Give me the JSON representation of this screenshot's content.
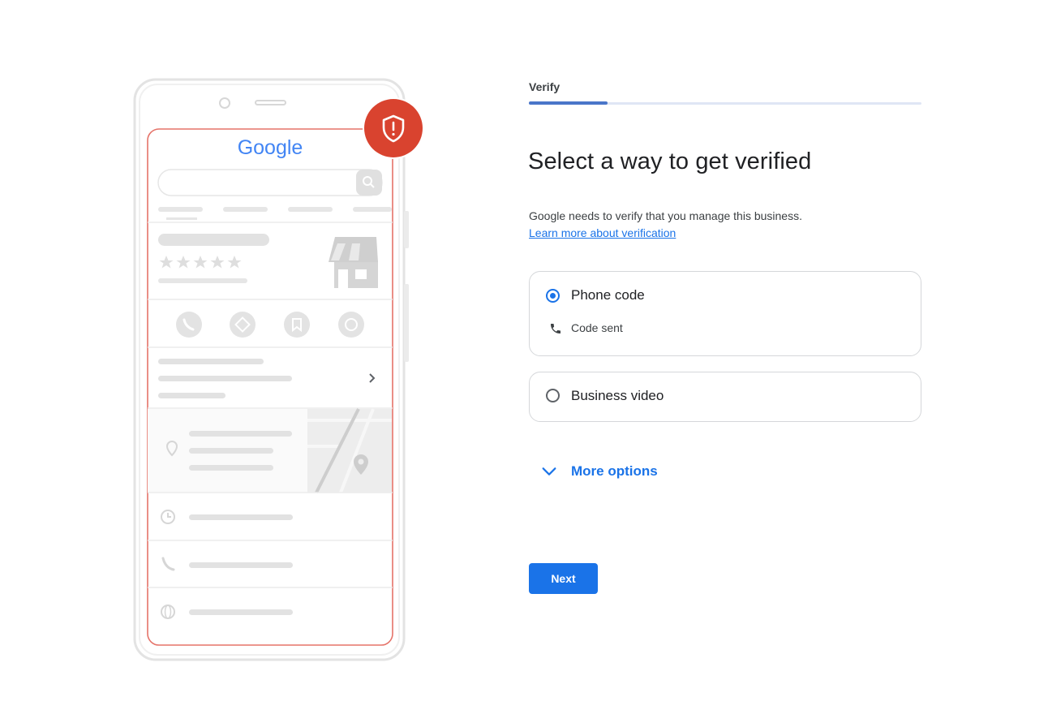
{
  "illustration": {
    "brand_text": "Google"
  },
  "stepper": {
    "step_label": "Verify",
    "progress_percent": 20
  },
  "main": {
    "title": "Select a way to get verified",
    "description": "Google needs to verify that you manage this business.",
    "learn_more": "Learn more about verification"
  },
  "options": [
    {
      "label": "Phone code",
      "selected": true,
      "sub_text": "Code sent",
      "sub_icon": "phone-icon"
    },
    {
      "label": "Business video",
      "selected": false
    }
  ],
  "more_options": {
    "label": "More options",
    "icon": "chevron-down-icon"
  },
  "actions": {
    "next_label": "Next"
  },
  "colors": {
    "accent": "#1a73e8",
    "shield": "#d9432f",
    "screen_border": "#e57369"
  }
}
